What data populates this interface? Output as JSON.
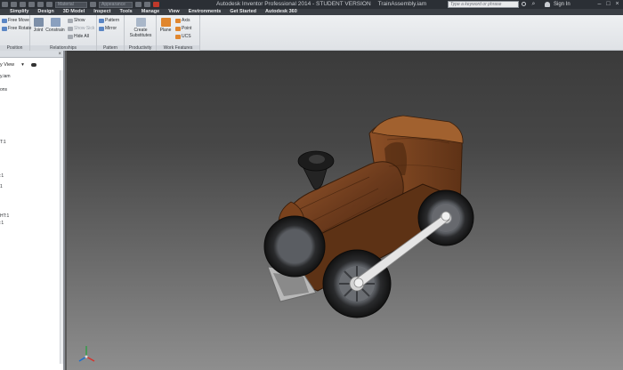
{
  "titlebar": {
    "style_combo": "Material",
    "appearance_combo": "Appearance",
    "app_title": "Autodesk Inventor Professional 2014 - STUDENT VERSION",
    "file_name": "TrainAssembly.iam",
    "search_placeholder": "Type a keyword or phrase",
    "sign_in": "Sign In"
  },
  "tabs": [
    "Simplify",
    "Design",
    "3D Model",
    "Inspect",
    "Tools",
    "Manage",
    "View",
    "Environments",
    "Get Started",
    "Autodesk 360"
  ],
  "ribbon": {
    "position": {
      "label": "Position",
      "free_move": "Free Move",
      "free_rotate": "Free Rotate"
    },
    "relationships": {
      "label": "Relationships",
      "joint": "Joint",
      "constrain": "Constrain",
      "show": "Show",
      "show_sick": "Show Sick",
      "hide_all": "Hide All"
    },
    "pattern": {
      "label": "Pattern",
      "pattern": "Pattern",
      "mirror": "Mirror"
    },
    "productivity": {
      "label": "Productivity",
      "create_substitutes": "Create\nSubstitutes"
    },
    "work_features": {
      "label": "Work Features",
      "plane": "Plane",
      "axis": "Axis",
      "point": "Point",
      "ucs": "UCS"
    }
  },
  "browser": {
    "view_select": "y View",
    "rows": [
      {
        "text": "y.iam"
      },
      {
        "text": "ons"
      },
      {
        "text": "T:1"
      },
      {
        "text": ":1"
      },
      {
        "text": "1"
      },
      {
        "text": "HT:1"
      },
      {
        "text": ":1"
      }
    ]
  },
  "colors": {
    "wood": "#6b3a1c",
    "wood_light": "#9a5a2e",
    "stack": "#1e1e1e",
    "rod": "#d8d8d8"
  }
}
